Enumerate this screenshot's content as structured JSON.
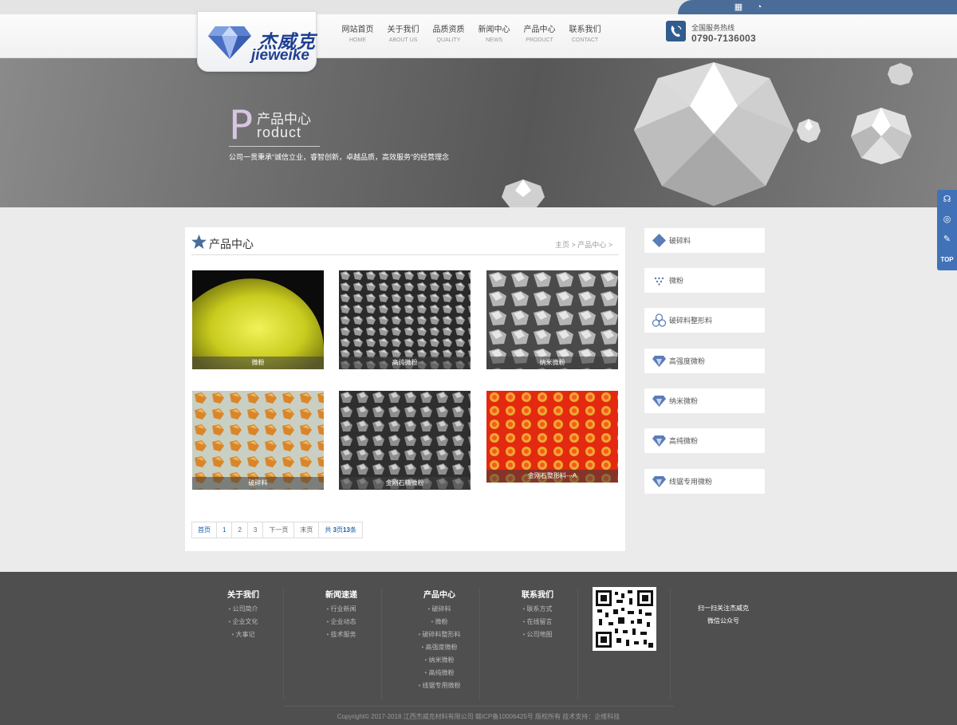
{
  "topbar": {
    "icons": [
      "qrcode-icon",
      "qq-icon"
    ]
  },
  "logo": {
    "cn": "杰威克",
    "en": "jieweike"
  },
  "nav": [
    {
      "zh": "网站首页",
      "en": "HOME"
    },
    {
      "zh": "关于我们",
      "en": "ABOUT US"
    },
    {
      "zh": "品质资质",
      "en": "QUALITY"
    },
    {
      "zh": "新闻中心",
      "en": "NEWS"
    },
    {
      "zh": "产品中心",
      "en": "PRODUCT"
    },
    {
      "zh": "联系我们",
      "en": "CONTACT"
    }
  ],
  "hotline": {
    "label": "全国服务热线",
    "number": "0790-7136003"
  },
  "banner": {
    "big_letter": "P",
    "title_zh": "产品中心",
    "title_en": "roduct",
    "slogan": "公司一贯秉承“诚信立业，睿智创新，卓越品质，高效服务”的经营理念"
  },
  "main": {
    "title": "产品中心",
    "breadcrumb": "主页 > 产品中心 >",
    "products": [
      {
        "caption": "微粉",
        "style": "yellow"
      },
      {
        "caption": "高纯微粉",
        "style": "gray"
      },
      {
        "caption": "纳米微粉",
        "style": "silver"
      },
      {
        "caption": "破碎料",
        "style": "amber"
      },
      {
        "caption": "金刚石精微粉",
        "style": "gray2"
      },
      {
        "caption": "金刚石整形料---A",
        "style": "red"
      }
    ],
    "pagination": {
      "first": "首页",
      "pages": [
        "1",
        "2",
        "3"
      ],
      "next": "下一页",
      "last": "末页",
      "total_prefix": "共 ",
      "total_bold": "3",
      "total_mid": "页",
      "total_count": "13",
      "total_suffix": "条"
    }
  },
  "sidebar": [
    {
      "label": "破碎料",
      "icon": "diamond-square-icon"
    },
    {
      "label": "微粉",
      "icon": "dots-icon"
    },
    {
      "label": "破碎料整形料",
      "icon": "circles-icon"
    },
    {
      "label": "高强度微粉",
      "icon": "gem-icon"
    },
    {
      "label": "纳米微粉",
      "icon": "gem-icon"
    },
    {
      "label": "高纯微粉",
      "icon": "gem-icon"
    },
    {
      "label": "线锯专用微粉",
      "icon": "gem-icon"
    }
  ],
  "float_tools": [
    "headset-icon",
    "wechat-icon",
    "edit-icon",
    "TOP"
  ],
  "footer": {
    "cols": [
      {
        "title": "关于我们",
        "links": [
          "公司简介",
          "企业文化",
          "大事记"
        ]
      },
      {
        "title": "新闻速递",
        "links": [
          "行业新闻",
          "企业动态",
          "技术服务"
        ]
      },
      {
        "title": "产品中心",
        "links": [
          "破碎料",
          "微粉",
          "破碎料整形料",
          "高强度微粉",
          "纳米微粉",
          "高纯微粉",
          "线锯专用微粉"
        ]
      },
      {
        "title": "联系我们",
        "links": [
          "联系方式",
          "在线留言",
          "公司地图"
        ]
      }
    ],
    "qr_text": [
      "扫一扫关注杰威克",
      "微信公众号"
    ],
    "copyright": "Copyright© 2017-2018 江西杰威克材料有限公司 赣ICP备10006425号 版权所有    技术支持：企维科技"
  },
  "colors": {
    "brand_blue": "#305c8f",
    "accent": "#4172b8",
    "footer_bg": "#4f4f4f"
  }
}
